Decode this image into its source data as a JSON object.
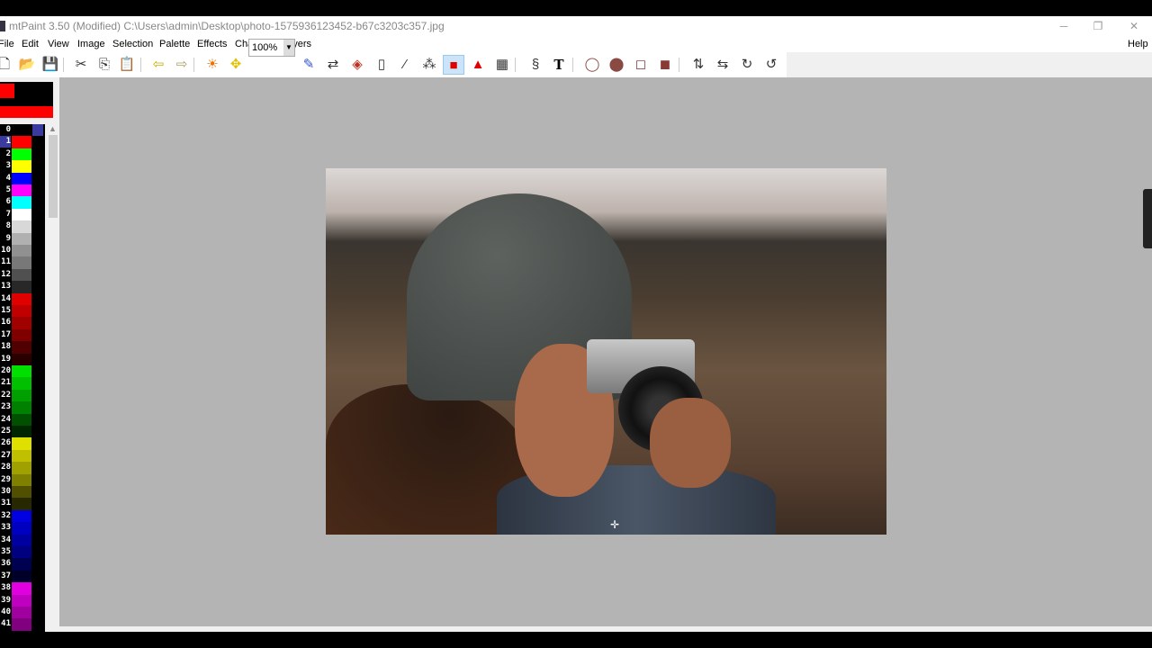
{
  "window": {
    "title": "mtPaint 3.50 (Modified) C:\\Users\\admin\\Desktop\\photo-1575936123452-b67c3203c357.jpg",
    "minimize": "─",
    "maximize": "❐",
    "close": "✕"
  },
  "menu": {
    "items": [
      "File",
      "Edit",
      "View",
      "Image",
      "Selection",
      "Palette",
      "Effects",
      "Channels",
      "Layers"
    ],
    "help": "Help"
  },
  "toolbar": {
    "zoom_value": "100%",
    "tools": [
      {
        "name": "new-icon",
        "glyph": "🗋"
      },
      {
        "name": "open-icon",
        "glyph": "📂"
      },
      {
        "name": "save-icon",
        "glyph": "💾"
      },
      {
        "name": "cut-icon",
        "glyph": "✂"
      },
      {
        "name": "copy-icon",
        "glyph": "⎘"
      },
      {
        "name": "paste-icon",
        "glyph": "📋"
      },
      {
        "name": "undo-icon",
        "glyph": "⇦"
      },
      {
        "name": "redo-icon",
        "glyph": "⇨"
      },
      {
        "name": "brightness-icon",
        "glyph": "☀"
      },
      {
        "name": "pan-icon",
        "glyph": "✥"
      },
      {
        "name": "paint-icon",
        "glyph": "✎"
      },
      {
        "name": "shuffle-icon",
        "glyph": "⇄"
      },
      {
        "name": "flood-fill-icon",
        "glyph": "◈"
      },
      {
        "name": "line-icon",
        "glyph": "▯"
      },
      {
        "name": "smudge-icon",
        "glyph": "⁄"
      },
      {
        "name": "clone-icon",
        "glyph": "⁂"
      },
      {
        "name": "select-rectangle-icon",
        "glyph": "■"
      },
      {
        "name": "select-polygon-icon",
        "glyph": "▲"
      },
      {
        "name": "color-picker-icon",
        "glyph": "▦"
      },
      {
        "name": "lasso-icon",
        "glyph": "§"
      },
      {
        "name": "text-icon",
        "glyph": "T"
      },
      {
        "name": "ellipse-outline-icon",
        "glyph": "◯"
      },
      {
        "name": "ellipse-filled-icon",
        "glyph": "⬤"
      },
      {
        "name": "rectangle-outline-icon",
        "glyph": "◻"
      },
      {
        "name": "rectangle-filled-icon",
        "glyph": "◼"
      },
      {
        "name": "flip-vertical-icon",
        "glyph": "⇅"
      },
      {
        "name": "flip-horizontal-icon",
        "glyph": "⇆"
      },
      {
        "name": "rotate-clockwise-icon",
        "glyph": "↻"
      },
      {
        "name": "rotate-anticlockwise-icon",
        "glyph": "↺"
      }
    ]
  },
  "palette": {
    "selected": 1,
    "colors": [
      "#000000",
      "#ff0000",
      "#00ff00",
      "#ffff00",
      "#0000ff",
      "#ff00ff",
      "#00ffff",
      "#ffffff",
      "#d8d8d8",
      "#b0b0b0",
      "#909090",
      "#787878",
      "#505050",
      "#282828",
      "#e00000",
      "#c00000",
      "#a00000",
      "#800000",
      "#500000",
      "#280000",
      "#00e000",
      "#00c000",
      "#00a000",
      "#008000",
      "#005000",
      "#002800",
      "#e0e000",
      "#c0c000",
      "#a0a000",
      "#808000",
      "#505000",
      "#282800",
      "#0000e0",
      "#0000c0",
      "#0000a0",
      "#000080",
      "#000050",
      "#000028",
      "#e000e0",
      "#c000c0",
      "#a000a0",
      "#800080"
    ]
  },
  "colors": {
    "primary": "#ff0000",
    "secondary": "#000000"
  }
}
